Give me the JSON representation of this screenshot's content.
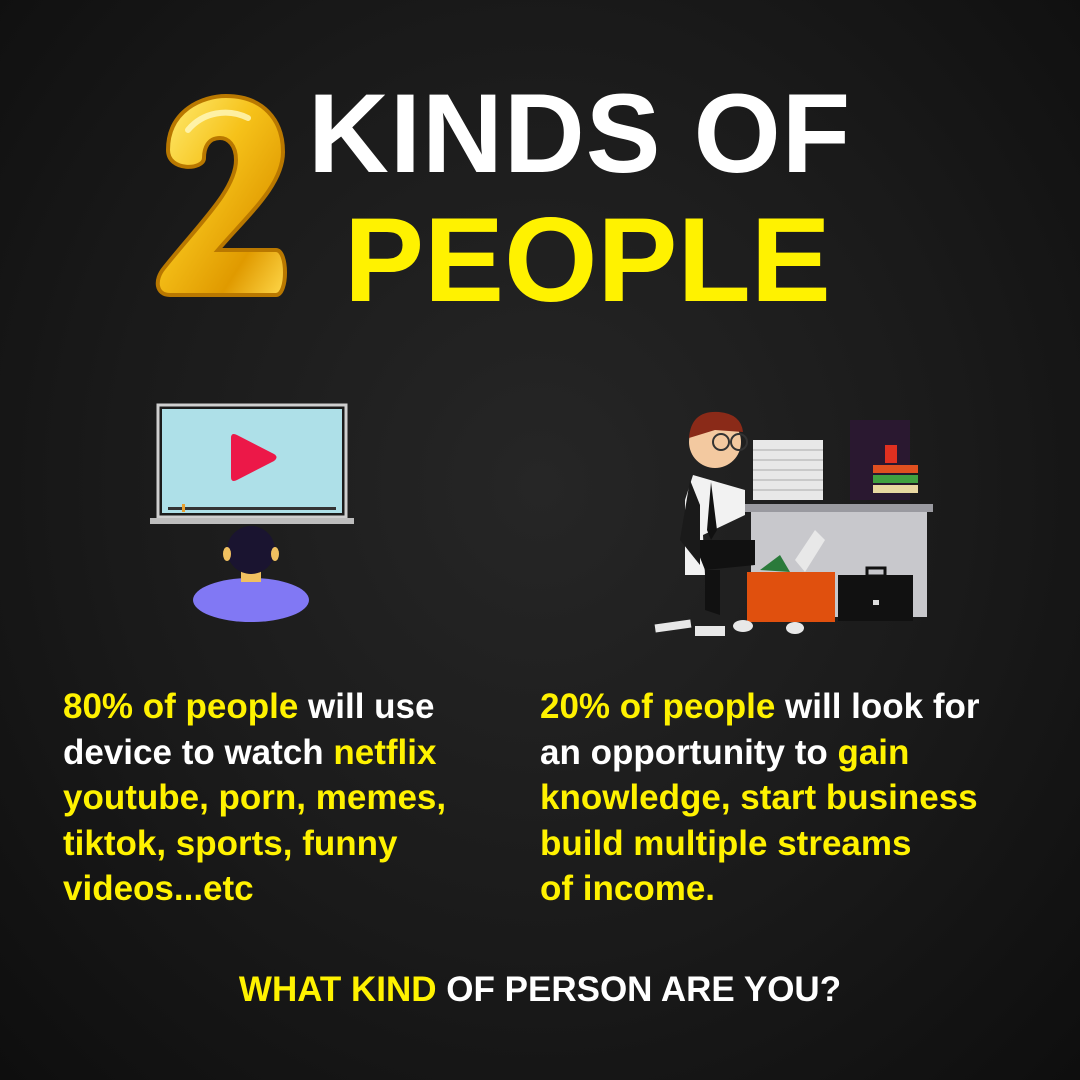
{
  "title": {
    "number": "2",
    "line1": "KINDS OF",
    "line2": "PEOPLE"
  },
  "left": {
    "lines": [
      [
        {
          "t": "80% of people",
          "hl": true
        },
        {
          "t": " will use",
          "hl": false
        }
      ],
      [
        {
          "t": "device to watch ",
          "hl": false
        },
        {
          "t": "netflix",
          "hl": true
        }
      ],
      [
        {
          "t": "youtube, porn, memes,",
          "hl": true
        }
      ],
      [
        {
          "t": "tiktok, sports, funny",
          "hl": true
        }
      ],
      [
        {
          "t": "videos...etc",
          "hl": true
        }
      ]
    ]
  },
  "right": {
    "lines": [
      [
        {
          "t": "20% of people",
          "hl": true
        },
        {
          "t": " will look for",
          "hl": false
        }
      ],
      [
        {
          "t": "an opportunity to ",
          "hl": false
        },
        {
          "t": "gain",
          "hl": true
        }
      ],
      [
        {
          "t": "knowledge, start business",
          "hl": true
        }
      ],
      [
        {
          "t": "build multiple streams",
          "hl": true
        }
      ],
      [
        {
          "t": "of income.",
          "hl": true
        }
      ]
    ]
  },
  "footer": {
    "highlight": "WHAT KIND",
    "rest": " OF PERSON ARE YOU?"
  },
  "colors": {
    "accent": "#fff200",
    "text": "#ffffff",
    "background": "#161616"
  }
}
